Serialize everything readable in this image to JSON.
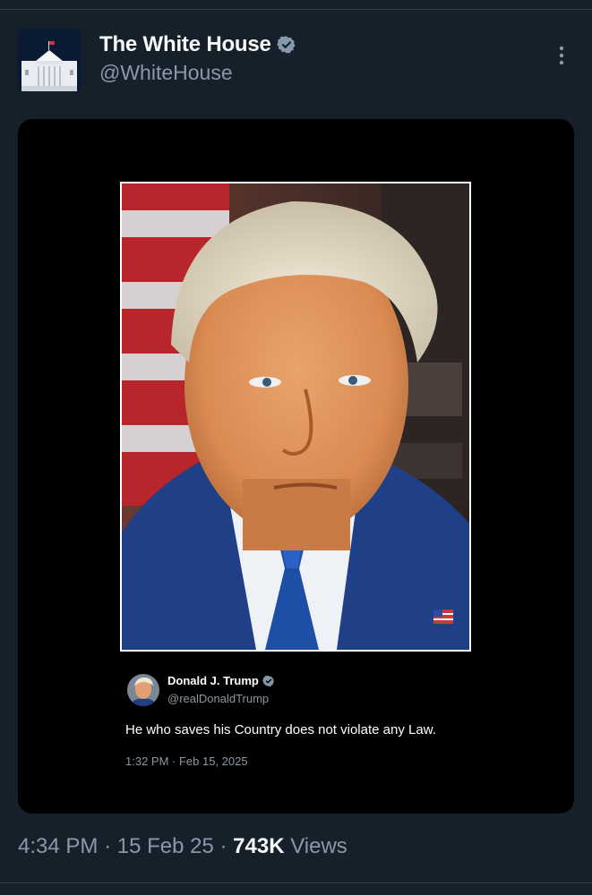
{
  "post": {
    "author": {
      "display_name": "The White House",
      "handle": "@WhiteHouse",
      "verified": true,
      "avatar_icon": "white-house-building-icon"
    },
    "menu_icon": "more-vertical-icon",
    "media": {
      "image": "portrait-photo",
      "quoted_post": {
        "author_name": "Donald J. Trump",
        "author_handle": "@realDonaldTrump",
        "verified": true,
        "text": "He who saves his Country does not violate any Law.",
        "timestamp": "1:32 PM · Feb 15, 2025"
      }
    },
    "time": "4:34 PM",
    "date": "15 Feb 25",
    "separator": "·",
    "views_count": "743K",
    "views_label": "Views"
  },
  "colors": {
    "background": "#15202b",
    "card": "#000000",
    "text_primary": "#f7f9f9",
    "text_secondary": "#8b98a5",
    "verified_badge": "#829aab"
  }
}
